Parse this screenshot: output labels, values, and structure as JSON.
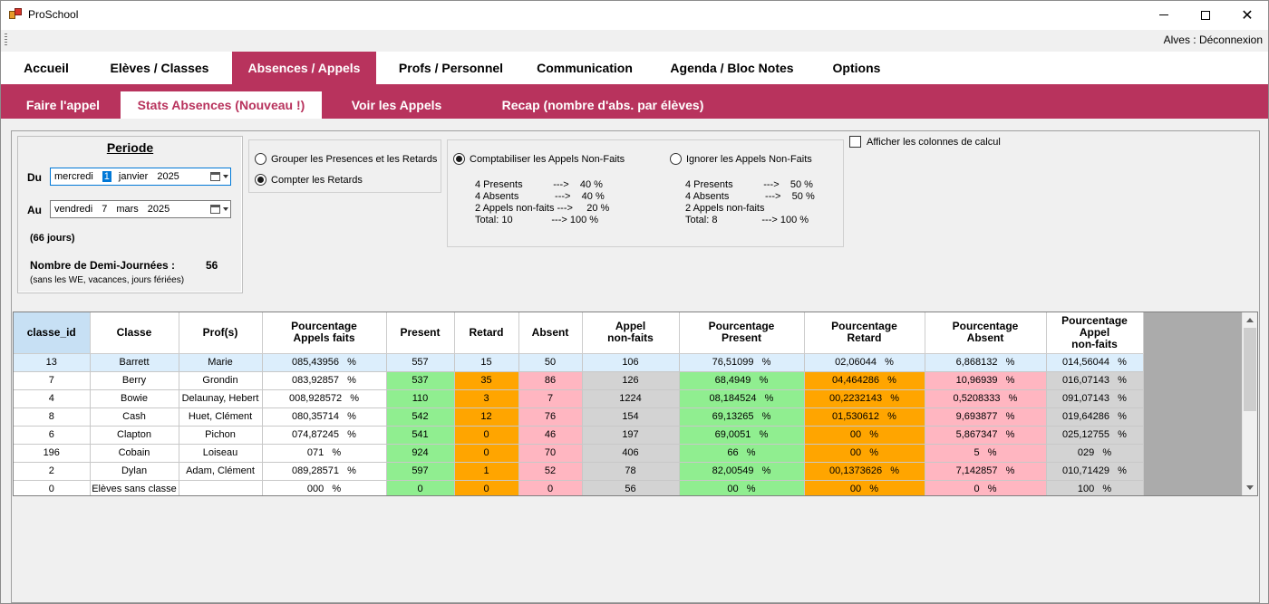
{
  "window": {
    "title": "ProSchool",
    "user_status": "Alves : Déconnexion",
    "close_glyph": "✕"
  },
  "main_tabs": [
    {
      "label": "Accueil",
      "active": false
    },
    {
      "label": "Elèves / Classes",
      "active": false
    },
    {
      "label": "Absences / Appels",
      "active": true
    },
    {
      "label": "Profs / Personnel",
      "active": false
    },
    {
      "label": "Communication",
      "active": false
    },
    {
      "label": "Agenda / Bloc Notes",
      "active": false
    },
    {
      "label": "Options",
      "active": false
    }
  ],
  "sub_tabs": [
    {
      "label": "Faire l'appel",
      "active": false
    },
    {
      "label": "Stats Absences (Nouveau !)",
      "active": true
    },
    {
      "label": "Voir les Appels",
      "active": false
    },
    {
      "label": "Recap (nombre d'abs. par élèves)",
      "active": false
    }
  ],
  "periode": {
    "title": "Periode",
    "du_label": "Du",
    "au_label": "Au",
    "du": {
      "weekday": "mercredi",
      "day": "1",
      "month": "janvier",
      "year": "2025"
    },
    "au": {
      "weekday": "vendredi",
      "day": "7",
      "month": "mars",
      "year": "2025"
    },
    "jours": "(66 jours)",
    "demi_journees_label": "Nombre de Demi-Journées :",
    "demi_journees_value": "56",
    "note": "(sans les WE, vacances, jours fériées)"
  },
  "grouping": {
    "option_group": "Grouper les Presences et les Retards",
    "option_count": "Compter les Retards",
    "selected": "count"
  },
  "non_faits": {
    "option_count": {
      "label": "Comptabiliser les Appels Non-Faits",
      "selected": true,
      "lines": [
        "4 Presents           --->    40 %",
        "4 Absents             --->    40 %",
        "2 Appels non-faits --->     20 %",
        "Total: 10              ---> 100 %"
      ]
    },
    "option_ignore": {
      "label": "Ignorer les Appels Non-Faits",
      "selected": false,
      "lines": [
        "4 Presents           --->    50 %",
        "4 Absents             --->    50 %",
        "2 Appels non-faits",
        "Total: 8                ---> 100 %"
      ]
    }
  },
  "show_calc_columns": {
    "label": "Afficher les colonnes de calcul",
    "checked": false
  },
  "table": {
    "columns": [
      "classe_id",
      "Classe",
      "Prof(s)",
      "Pourcentage\nAppels faits",
      "Present",
      "Retard",
      "Absent",
      "Appel\nnon-faits",
      "Pourcentage\nPresent",
      "Pourcentage\nRetard",
      "Pourcentage\nAbsent",
      "Pourcentage\nAppel\nnon-faits"
    ],
    "rows": [
      [
        "13",
        "Barrett",
        "Marie",
        "085,43956   %",
        "557",
        "15",
        "50",
        "106",
        "76,51099   %",
        "02,06044   %",
        "6,868132   %",
        "014,56044   %"
      ],
      [
        "7",
        "Berry",
        "Grondin",
        "083,92857   %",
        "537",
        "35",
        "86",
        "126",
        "68,4949   %",
        "04,464286   %",
        "10,96939   %",
        "016,07143   %"
      ],
      [
        "4",
        "Bowie",
        "Delaunay, Hebert",
        "008,928572   %",
        "110",
        "3",
        "7",
        "1224",
        "08,184524   %",
        "00,2232143   %",
        "0,5208333   %",
        "091,07143   %"
      ],
      [
        "8",
        "Cash",
        "Huet, Clément",
        "080,35714   %",
        "542",
        "12",
        "76",
        "154",
        "69,13265   %",
        "01,530612   %",
        "9,693877   %",
        "019,64286   %"
      ],
      [
        "6",
        "Clapton",
        "Pichon",
        "074,87245   %",
        "541",
        "0",
        "46",
        "197",
        "69,0051   %",
        "00   %",
        "5,867347   %",
        "025,12755   %"
      ],
      [
        "196",
        "Cobain",
        "Loiseau",
        "071   %",
        "924",
        "0",
        "70",
        "406",
        "66   %",
        "00   %",
        "5   %",
        "029   %"
      ],
      [
        "2",
        "Dylan",
        "Adam, Clément",
        "089,28571   %",
        "597",
        "1",
        "52",
        "78",
        "82,00549   %",
        "00,1373626   %",
        "7,142857   %",
        "010,71429   %"
      ],
      [
        "0",
        "Elèves sans classe",
        "",
        "000   %",
        "0",
        "0",
        "0",
        "56",
        "00   %",
        "00   %",
        "0   %",
        "100   %"
      ]
    ],
    "selected_row": 0
  }
}
